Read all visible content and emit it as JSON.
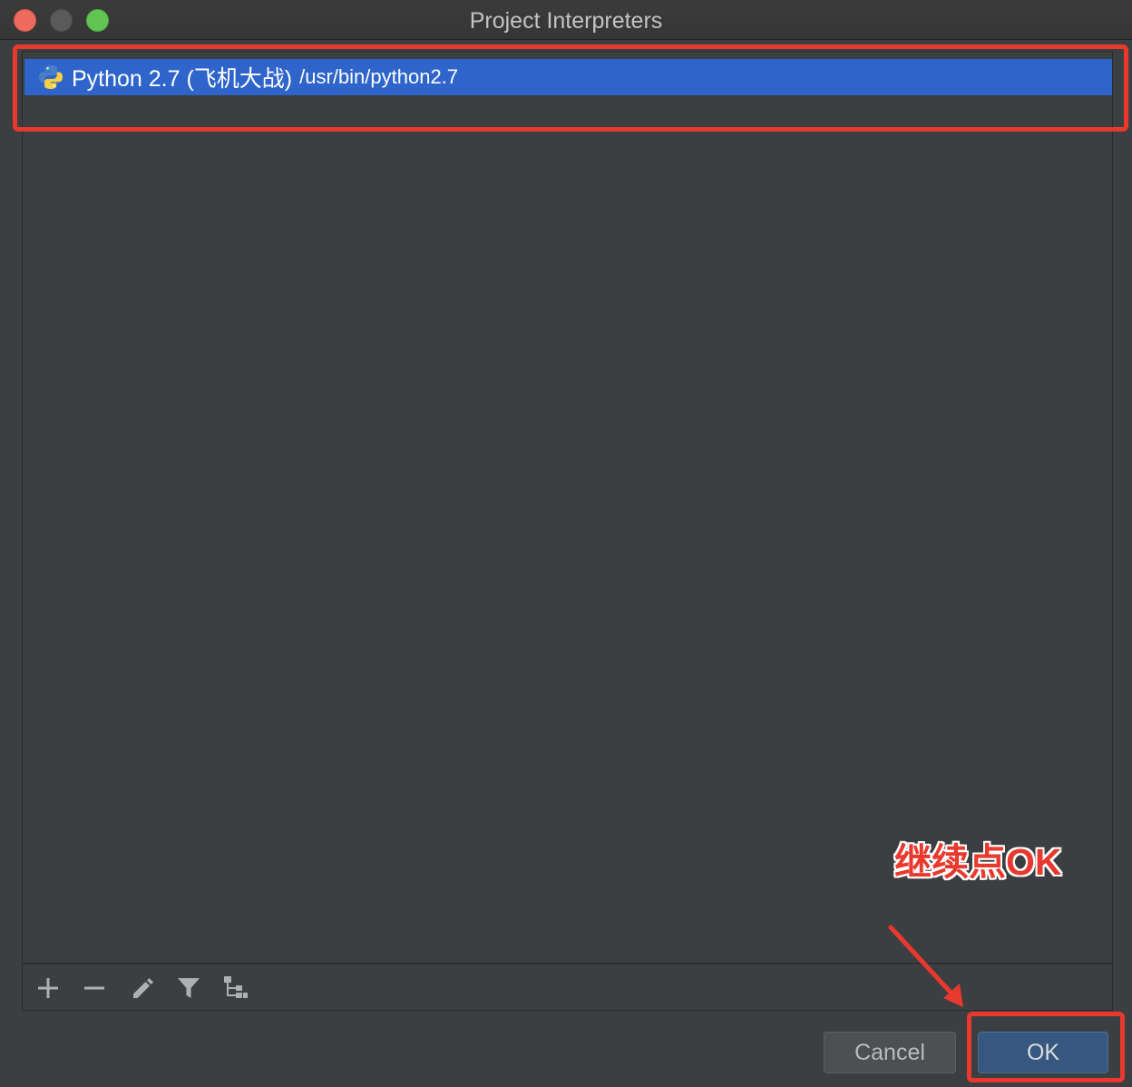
{
  "window": {
    "title": "Project Interpreters"
  },
  "interpreters": [
    {
      "name": "Python 2.7 (飞机大战)",
      "path": "/usr/bin/python2.7",
      "icon": "python-icon",
      "selected": true
    }
  ],
  "toolbar": {
    "add_icon": "plus-icon",
    "remove_icon": "minus-icon",
    "edit_icon": "pencil-icon",
    "filter_icon": "filter-icon",
    "tree_icon": "tree-icon"
  },
  "buttons": {
    "cancel_label": "Cancel",
    "ok_label": "OK"
  },
  "annotation": {
    "text": "继续点OK",
    "color": "#e8392e"
  },
  "colors": {
    "selection": "#2f65ca",
    "background": "#3c3f41",
    "ok_button": "#365880"
  }
}
